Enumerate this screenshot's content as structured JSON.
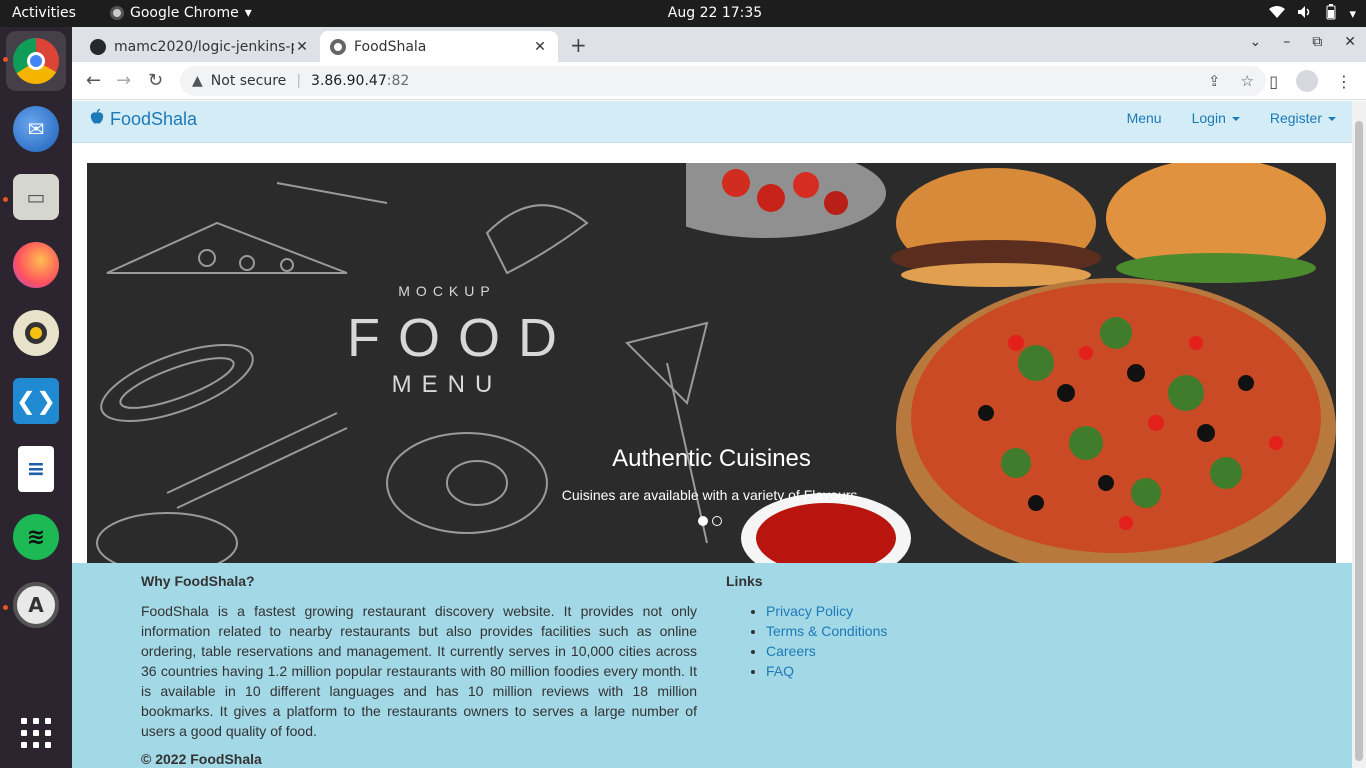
{
  "os": {
    "activities": "Activities",
    "app_name": "Google Chrome",
    "clock": "Aug 22  17:35"
  },
  "browser": {
    "tabs": [
      {
        "title": "mamc2020/logic-jenkins-p",
        "active": false
      },
      {
        "title": "FoodShala",
        "active": true
      }
    ],
    "security_label": "Not secure",
    "url_host": "3.86.90.47",
    "url_port": ":82"
  },
  "site": {
    "brand": "FoodShala",
    "nav": {
      "menu": "Menu",
      "login": "Login",
      "register": "Register"
    },
    "carousel": {
      "mockup_top": "MOCKUP",
      "mockup_food": "FOOD",
      "mockup_menu": "MENU",
      "heading": "Authentic Cuisines",
      "text": "Cuisines are available with a variety of Flavours.",
      "slide_count": 2,
      "active_slide": 1
    },
    "footer": {
      "why_title": "Why FoodShala?",
      "why_text": "FoodShala is a fastest growing restaurant discovery website. It provides not only information related to nearby restaurants but also provides facilities such as online ordering, table reservations and management. It currently serves in 10,000 cities across 36 countries having 1.2 million popular restaurants with 80 million foodies every month. It is available in 10 different languages and has 10 million reviews with 18 million bookmarks. It gives a platform to the restaurants owners to serves a large number of users a good quality of food.",
      "links_title": "Links",
      "links": [
        "Privacy Policy",
        "Terms & Conditions",
        "Careers",
        "FAQ"
      ],
      "copyright": "© 2022 FoodShala"
    }
  },
  "colors": {
    "nav_bg": "#d4ecf6",
    "footer_bg": "#a3d8e6",
    "link": "#1d7ab7"
  }
}
